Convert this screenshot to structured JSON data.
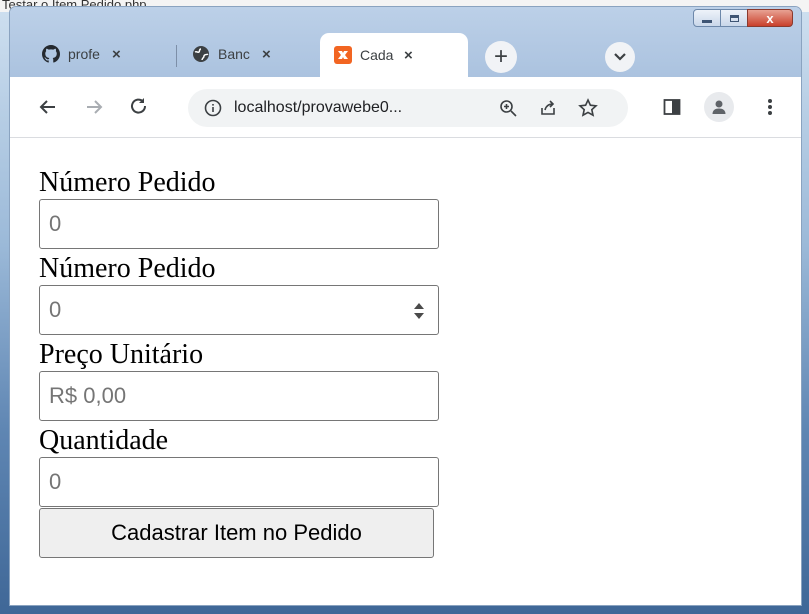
{
  "caption": "Testar o Item Pedido.php",
  "window": {
    "controls": {
      "minimize": "minimize",
      "maximize": "maximize",
      "close": "x"
    }
  },
  "tabs": [
    {
      "title": "profe",
      "icon": "github-icon",
      "close": "×"
    },
    {
      "title": "Banc",
      "icon": "globe-icon",
      "close": "×"
    },
    {
      "title": "Cada",
      "icon": "xampp-icon",
      "close": "×",
      "active": true
    }
  ],
  "new_tab_label": "+",
  "address_bar": {
    "url": "localhost/provawebe0..."
  },
  "form": {
    "fields": [
      {
        "label": "Número Pedido",
        "value": "0"
      },
      {
        "label": "Número Pedido",
        "value": "0"
      },
      {
        "label": "Preço Unitário",
        "value": "R$ 0,00"
      },
      {
        "label": "Quantidade",
        "value": "0"
      }
    ],
    "submit_label": "Cadastrar Item no Pedido"
  },
  "colors": {
    "accent_xampp": "#f26522",
    "titlebar": "#bcd0e8",
    "close_button": "#c9402b"
  }
}
